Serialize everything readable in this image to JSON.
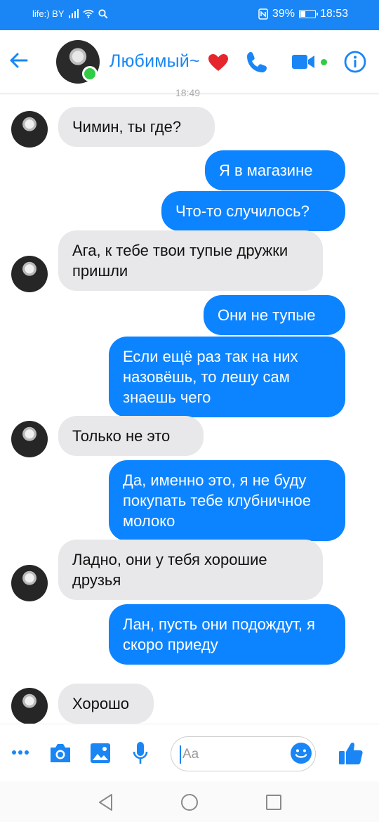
{
  "status_bar": {
    "carrier": "life:) BY",
    "battery": "39%",
    "battery_level": 0.39,
    "time": "18:53"
  },
  "header": {
    "contact_name": "Любимый~"
  },
  "timestamp": "18:49",
  "messages": [
    {
      "dir": "in",
      "text": "Чимин, ты где?"
    },
    {
      "dir": "out",
      "text": "Я в магазине"
    },
    {
      "dir": "out",
      "text": "Что-то случилось?"
    },
    {
      "dir": "in",
      "text": "Ага, к тебе твои тупые дружки пришли"
    },
    {
      "dir": "out",
      "text": "Они не тупые"
    },
    {
      "dir": "out",
      "text": "Если ещё раз так на них назовёшь, то лешу сам знаешь чего"
    },
    {
      "dir": "in",
      "text": "Только не это"
    },
    {
      "dir": "out",
      "text": "Да, именно это, я не буду покупать тебе клубничное молоко"
    },
    {
      "dir": "in",
      "text": "Ладно, они у тебя хорошие друзья"
    },
    {
      "dir": "out",
      "text": "Лан, пусть они подождут, я скоро приеду"
    },
    {
      "dir": "in",
      "text": "Хорошо"
    }
  ],
  "composer": {
    "placeholder": "Aa"
  },
  "colors": {
    "accent": "#1a86f5",
    "outgoing_bubble": "#0d84ff",
    "incoming_bubble": "#e8e8ea",
    "online": "#31cc46"
  }
}
